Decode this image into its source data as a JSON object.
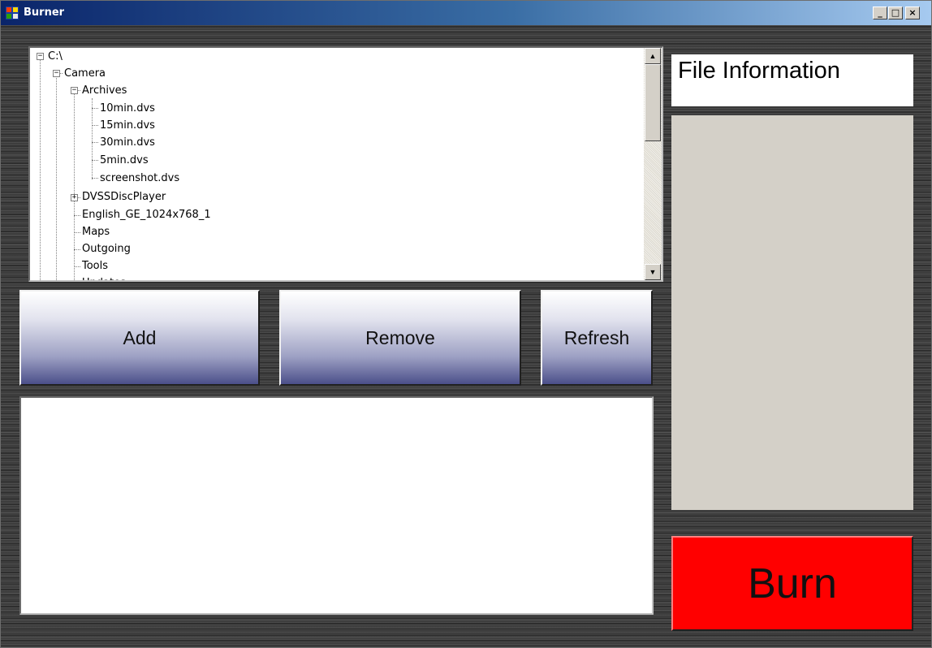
{
  "window": {
    "title": "Burner",
    "controls": {
      "minimize": "_",
      "maximize": "□",
      "close": "×"
    }
  },
  "tree": {
    "nodes": [
      {
        "label": "C:\\",
        "expander": "−"
      },
      {
        "label": "Camera",
        "expander": "−"
      },
      {
        "label": "Archives",
        "expander": "−"
      },
      {
        "label": "10min.dvs"
      },
      {
        "label": "15min.dvs"
      },
      {
        "label": "30min.dvs"
      },
      {
        "label": "5min.dvs"
      },
      {
        "label": "screenshot.dvs"
      },
      {
        "label": "DVSSDiscPlayer",
        "expander": "+"
      },
      {
        "label": "English_GE_1024x768_1"
      },
      {
        "label": "Maps"
      },
      {
        "label": "Outgoing"
      },
      {
        "label": "Tools"
      },
      {
        "label": "Updates"
      }
    ],
    "scroll_up": "▲",
    "scroll_down": "▼"
  },
  "buttons": {
    "add": "Add",
    "remove": "Remove",
    "refresh": "Refresh",
    "burn": "Burn"
  },
  "file_info": {
    "title": "File Information"
  },
  "colors": {
    "burn_button": "#ff0000",
    "info_panel": "#d4d0c8",
    "titlebar_start": "#0a246a",
    "titlebar_end": "#a6caf0"
  }
}
